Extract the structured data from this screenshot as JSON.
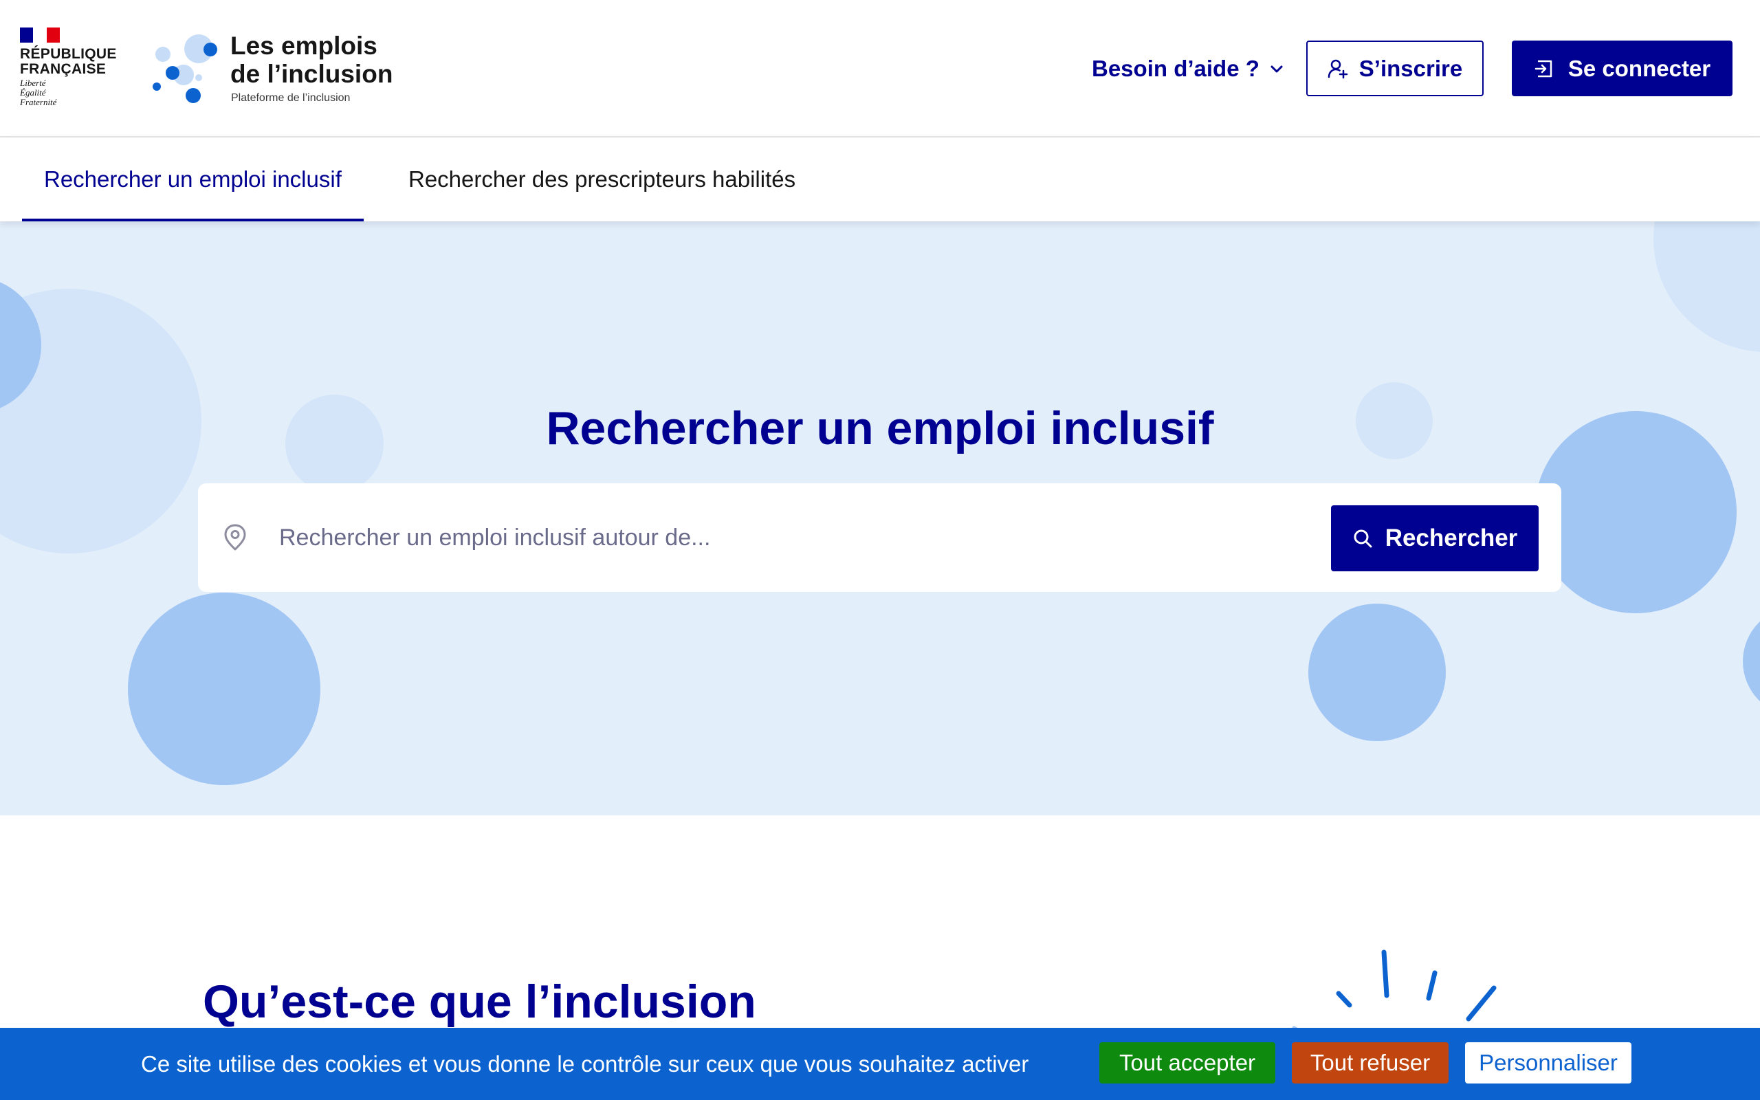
{
  "header": {
    "republique": {
      "flag_colors": [
        "#000091",
        "#ffffff",
        "#e1000f"
      ],
      "name": "RÉPUBLIQUE\nFRANÇAISE",
      "motto": "Liberté\nÉgalité\nFraternité"
    },
    "brand": {
      "title": "Les emplois\nde l’inclusion",
      "subtitle": "Plateforme de l’inclusion"
    },
    "help_label": "Besoin d’aide ?",
    "signup_label": "S’inscrire",
    "login_label": "Se connecter"
  },
  "tabs": [
    {
      "label": "Rechercher un emploi inclusif",
      "active": true
    },
    {
      "label": "Rechercher des prescripteurs habilités",
      "active": false
    }
  ],
  "hero": {
    "title": "Rechercher un emploi inclusif",
    "search_placeholder": "Rechercher un emploi inclusif autour de...",
    "search_value": "",
    "search_button": "Rechercher"
  },
  "section": {
    "title": "Qu’est-ce que l’inclusion"
  },
  "cookie_banner": {
    "text": "Ce site utilise des cookies et vous donne le contrôle sur ceux que vous souhaitez activer",
    "accept_label": "Tout accepter",
    "refuse_label": "Tout refuser",
    "customize_label": "Personnaliser"
  },
  "colors": {
    "primary": "#000091",
    "hero_bg": "#e3eefb",
    "bubble_strong": "#a1c6f3",
    "bubble_light": "#d4e5f9",
    "cookie_bg": "#0c63d0",
    "accept": "#0e8a0e",
    "refuse": "#c0450e"
  },
  "icons": {
    "help_toggle": "chevron-down-icon",
    "signup": "user-add-icon",
    "login": "login-icon",
    "search_field": "map-pin-icon",
    "search_button": "search-icon"
  }
}
